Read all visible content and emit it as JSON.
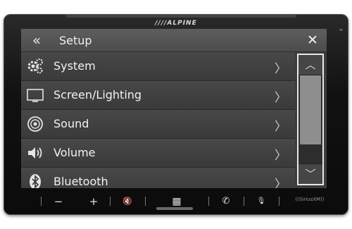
{
  "brand": "////ALPINE",
  "header": {
    "title": "Setup",
    "back_glyph": "«",
    "close_glyph": "✕"
  },
  "menu": [
    {
      "label": "System",
      "icon": "gears-icon"
    },
    {
      "label": "Screen/Lighting",
      "icon": "monitor-icon"
    },
    {
      "label": "Sound",
      "icon": "speaker-icon"
    },
    {
      "label": "Volume",
      "icon": "volume-icon"
    },
    {
      "label": "Bluetooth",
      "icon": "bluetooth-icon"
    }
  ],
  "scrollbar": {
    "up_glyph": "︿",
    "down_glyph": "﹀",
    "position_fraction": 0.0,
    "visible_fraction": 0.78
  },
  "hardware_buttons": {
    "minus": "−",
    "plus": "+",
    "mute": "🔇",
    "home": "▦",
    "phone": "✆",
    "mic": "🎙",
    "siriusxm": "((SiriusXM))"
  },
  "colors": {
    "accent": "#e8e8e8",
    "screen_bg": "#3c3c3c"
  }
}
